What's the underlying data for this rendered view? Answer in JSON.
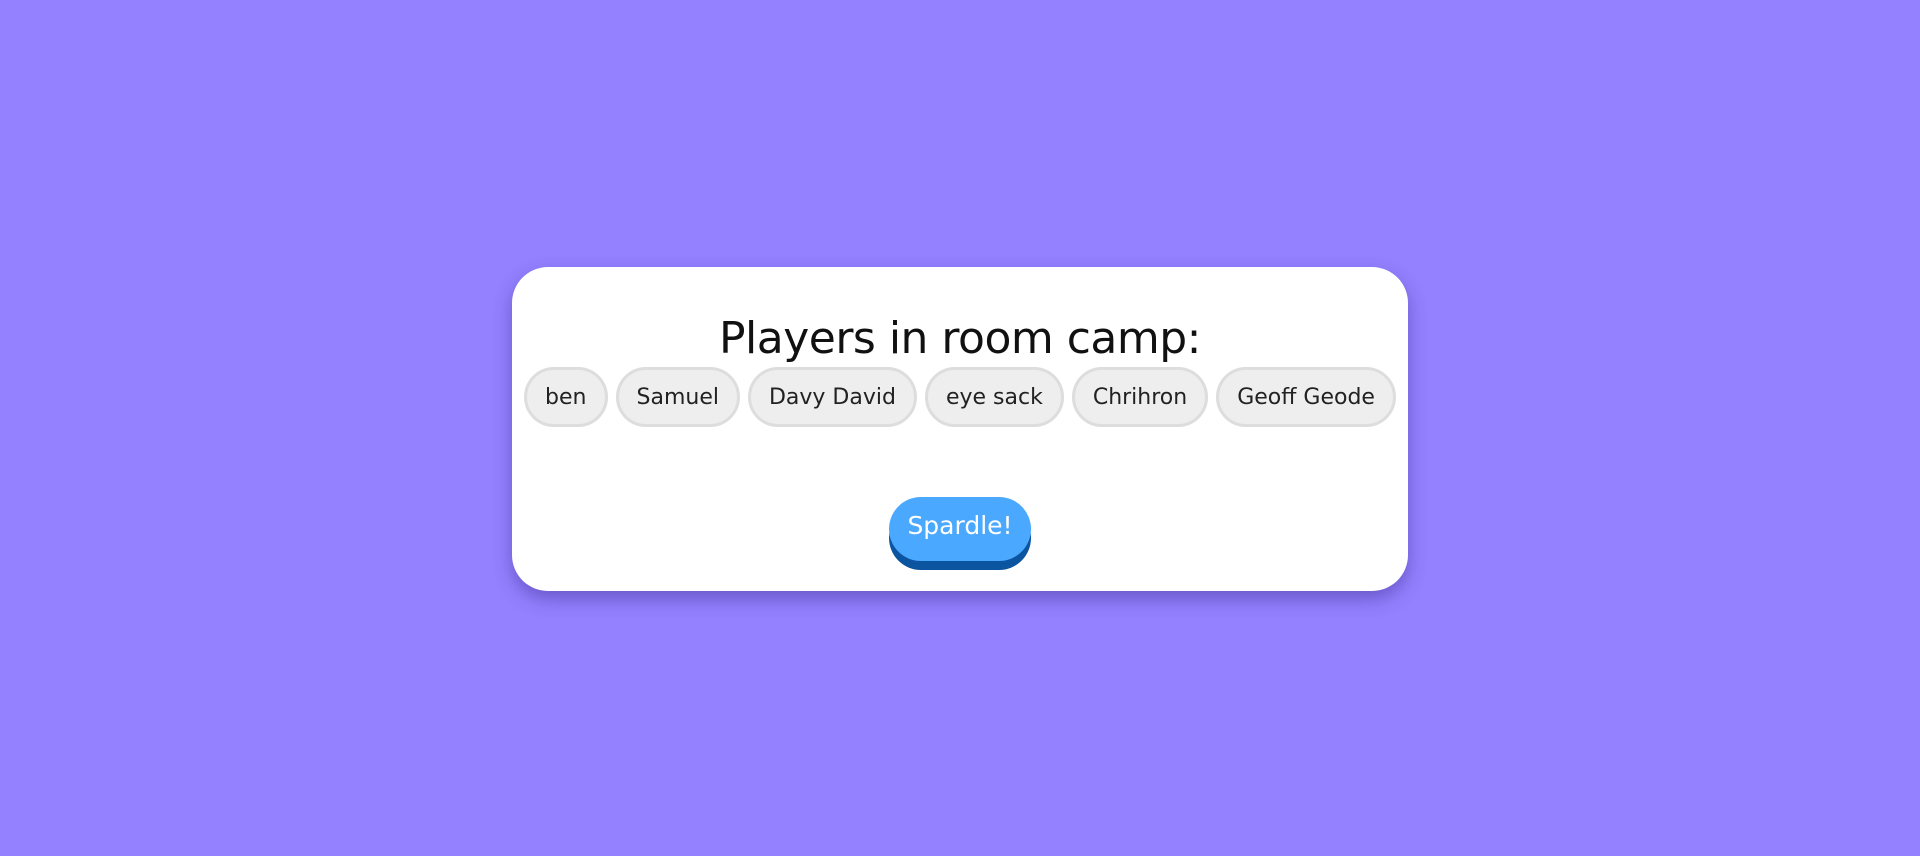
{
  "lobby": {
    "title": "Players in room camp:",
    "players": [
      {
        "name": "ben"
      },
      {
        "name": "Samuel"
      },
      {
        "name": "Davy David"
      },
      {
        "name": "eye sack"
      },
      {
        "name": "Chrihron"
      },
      {
        "name": "Geoff Geode"
      }
    ],
    "start_button_label": "Spardle!"
  },
  "colors": {
    "background": "#9381ff",
    "card": "#ffffff",
    "chip_fill": "#eeeeee",
    "chip_border": "#dddddd",
    "button": "#4aa8ff",
    "button_shadow": "#0a54a0"
  }
}
